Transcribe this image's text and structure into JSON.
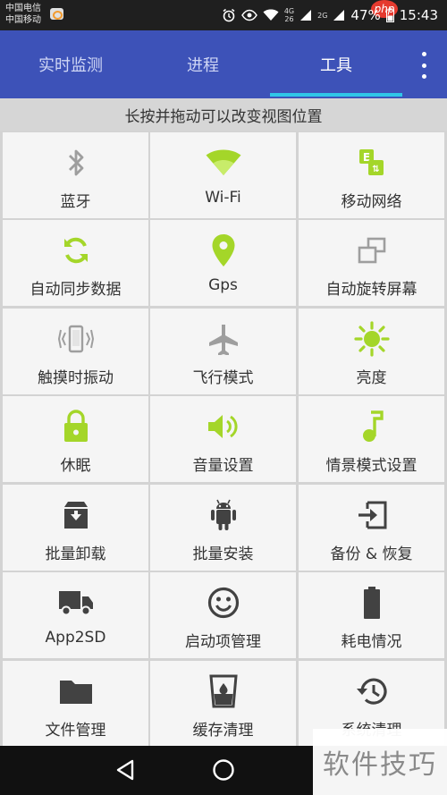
{
  "status_bar": {
    "carrier1": "中国电信",
    "carrier2": "中国移动",
    "net1": "4G",
    "net2": "26",
    "net3": "2G",
    "battery": "47%",
    "time": "15:43",
    "badge": "php"
  },
  "tabs": [
    {
      "label": "实时监测"
    },
    {
      "label": "进程"
    },
    {
      "label": "工具"
    }
  ],
  "active_tab": "工具",
  "hint": "长按并拖动可以改变视图位置",
  "tools": [
    {
      "label": "蓝牙",
      "icon": "bluetooth-icon",
      "color": "#9e9e9e"
    },
    {
      "label": "Wi-Fi",
      "icon": "wifi-icon",
      "color": "#a4d629"
    },
    {
      "label": "移动网络",
      "icon": "mobile-network-icon",
      "color": "#a4d629"
    },
    {
      "label": "自动同步数据",
      "icon": "sync-icon",
      "color": "#a4d629"
    },
    {
      "label": "Gps",
      "icon": "location-pin-icon",
      "color": "#a4d629"
    },
    {
      "label": "自动旋转屏幕",
      "icon": "rotate-screen-icon",
      "color": "#9e9e9e"
    },
    {
      "label": "触摸时振动",
      "icon": "vibrate-icon",
      "color": "#9e9e9e"
    },
    {
      "label": "飞行模式",
      "icon": "airplane-icon",
      "color": "#9e9e9e"
    },
    {
      "label": "亮度",
      "icon": "brightness-icon",
      "color": "#a4d629"
    },
    {
      "label": "休眠",
      "icon": "lock-icon",
      "color": "#a4d629"
    },
    {
      "label": "音量设置",
      "icon": "volume-icon",
      "color": "#a4d629"
    },
    {
      "label": "情景模式设置",
      "icon": "music-note-icon",
      "color": "#a4d629"
    },
    {
      "label": "批量卸载",
      "icon": "archive-icon",
      "color": "#424242"
    },
    {
      "label": "批量安装",
      "icon": "android-icon",
      "color": "#424242"
    },
    {
      "label": "备份 & 恢复",
      "icon": "import-icon",
      "color": "#424242"
    },
    {
      "label": "App2SD",
      "icon": "truck-icon",
      "color": "#424242"
    },
    {
      "label": "启动项管理",
      "icon": "smiley-icon",
      "color": "#424242"
    },
    {
      "label": "耗电情况",
      "icon": "battery-icon",
      "color": "#424242"
    },
    {
      "label": "文件管理",
      "icon": "folder-icon",
      "color": "#424242"
    },
    {
      "label": "缓存清理",
      "icon": "cup-icon",
      "color": "#424242"
    },
    {
      "label": "系统清理",
      "icon": "history-icon",
      "color": "#424242"
    }
  ],
  "watermark": "软件技巧",
  "colors": {
    "appbar": "#3d52b8",
    "tab_indicator": "#2ec6e8",
    "accent_green": "#a4d629"
  }
}
